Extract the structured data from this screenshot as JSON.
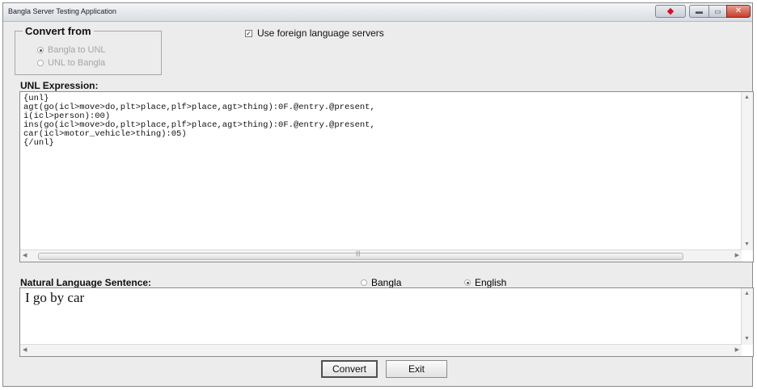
{
  "window": {
    "title": "Bangla Server Testing Application",
    "controls": {
      "extra_icon": "red-diamond-icon",
      "minimize_icon": "minimize-icon",
      "maximize_icon": "maximize-icon",
      "close_icon": "close-icon"
    }
  },
  "convert_from": {
    "title": "Convert from",
    "options": [
      {
        "label": "Bangla to UNL",
        "selected": true,
        "enabled": false
      },
      {
        "label": "UNL  to Bangla",
        "selected": false,
        "enabled": false
      }
    ]
  },
  "foreign_servers": {
    "label": "Use foreign language servers",
    "checked": true
  },
  "unl_expression": {
    "label": "UNL Expression:",
    "lines": [
      "{unl}",
      "agt(go(icl>move>do,plt>place,plf>place,agt>thing):0F.@entry.@present,",
      "i(icl>person):00)",
      "ins(go(icl>move>do,plt>place,plf>place,agt>thing):0F.@entry.@present,",
      "car(icl>motor_vehicle>thing):05)",
      "{/unl}"
    ]
  },
  "natural_language": {
    "label": "Natural Language Sentence:",
    "options": [
      {
        "label": "Bangla",
        "selected": false
      },
      {
        "label": "English",
        "selected": true
      }
    ],
    "sentence": "I go by car"
  },
  "buttons": {
    "convert": "Convert",
    "exit": "Exit"
  },
  "colors": {
    "window_bg": "#ececec",
    "close_button": "#c63e2b",
    "textbox_bg": "#ffffff"
  }
}
